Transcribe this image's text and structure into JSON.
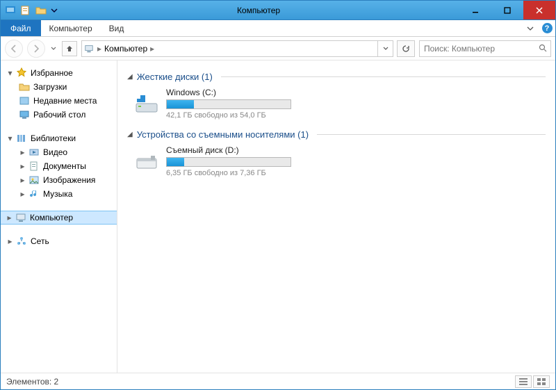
{
  "titlebar": {
    "title": "Компьютер"
  },
  "ribbon": {
    "file": "Файл",
    "tabs": [
      "Компьютер",
      "Вид"
    ]
  },
  "address": {
    "crumb": "Компьютер",
    "search_placeholder": "Поиск: Компьютер"
  },
  "sidebar": {
    "favorites": {
      "label": "Избранное",
      "items": [
        "Загрузки",
        "Недавние места",
        "Рабочий стол"
      ]
    },
    "libraries": {
      "label": "Библиотеки",
      "items": [
        "Видео",
        "Документы",
        "Изображения",
        "Музыка"
      ]
    },
    "computer": {
      "label": "Компьютер"
    },
    "network": {
      "label": "Сеть"
    }
  },
  "content": {
    "groups": [
      {
        "title": "Жесткие диски (1)",
        "drives": [
          {
            "name": "Windows (C:)",
            "free_text": "42,1 ГБ свободно из 54,0 ГБ",
            "fill_pct": 22
          }
        ]
      },
      {
        "title": "Устройства со съемными носителями (1)",
        "drives": [
          {
            "name": "Съемный диск (D:)",
            "free_text": "6,35 ГБ свободно из 7,36 ГБ",
            "fill_pct": 14
          }
        ]
      }
    ]
  },
  "statusbar": {
    "text": "Элементов: 2"
  }
}
